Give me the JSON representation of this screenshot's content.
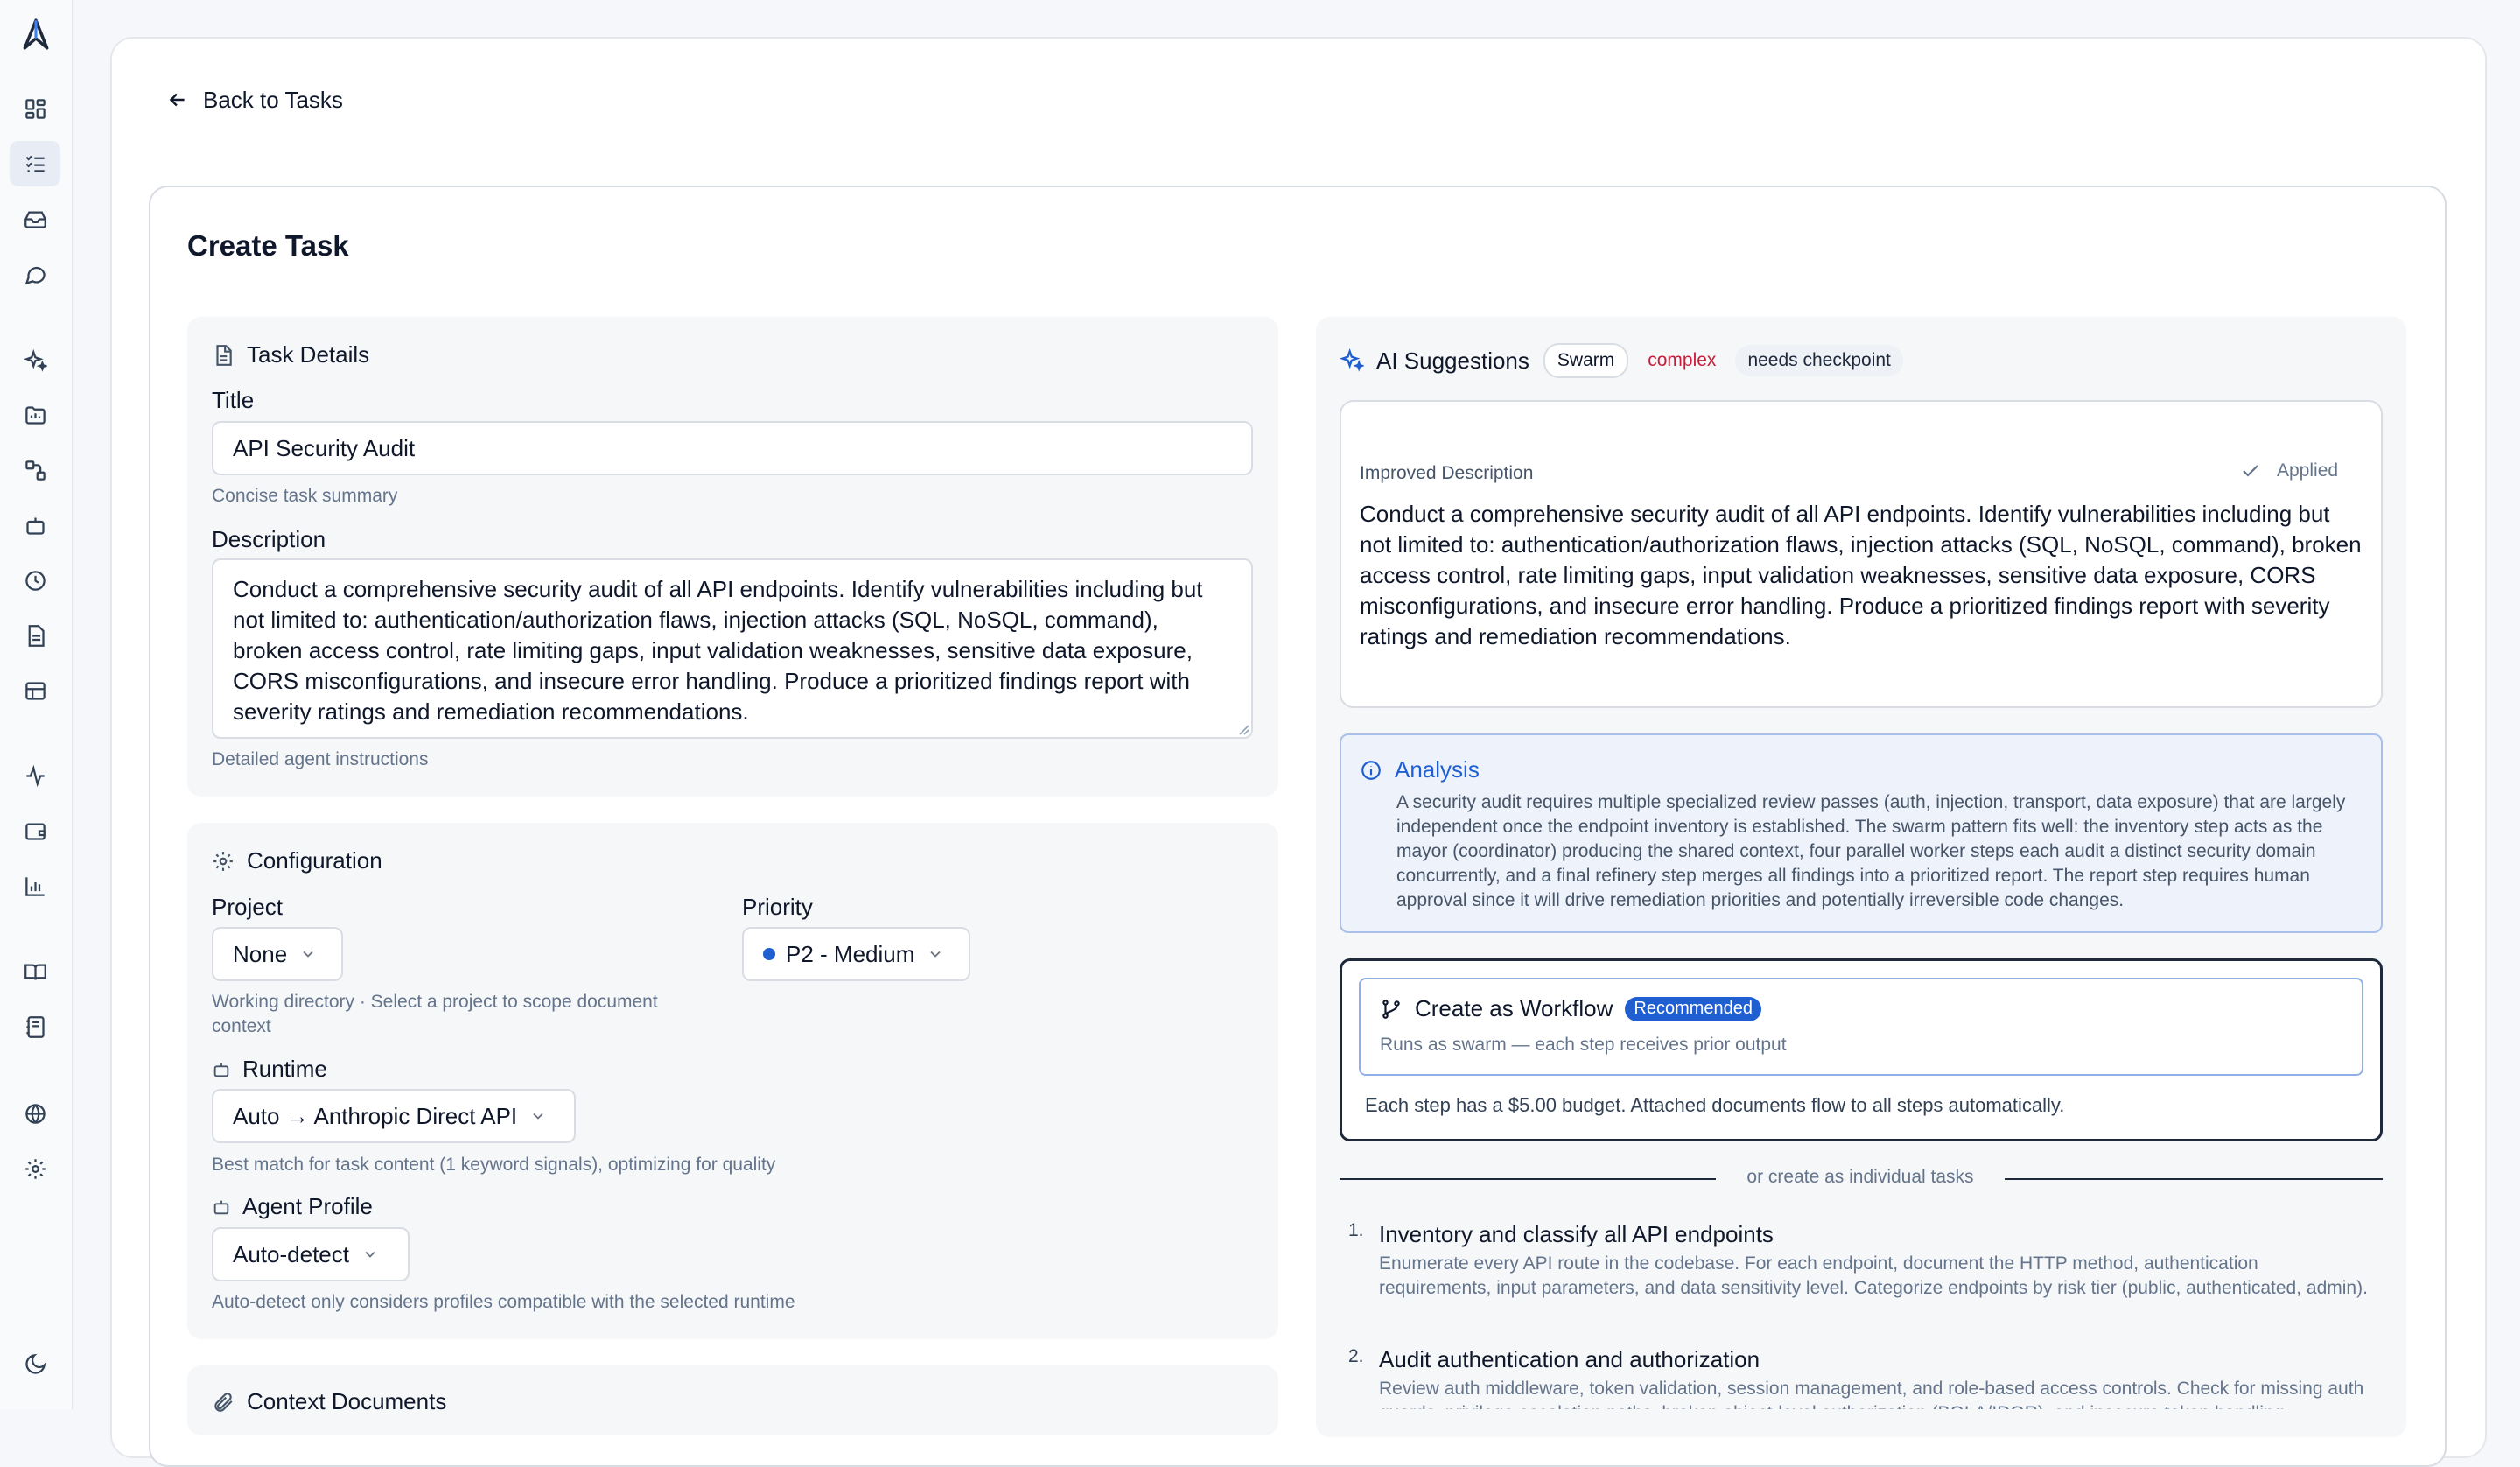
{
  "nav": {
    "back_label": "Back to Tasks"
  },
  "page": {
    "title": "Create Task"
  },
  "task_details": {
    "heading": "Task Details",
    "title_label": "Title",
    "title_value": "API Security Audit",
    "title_hint": "Concise task summary",
    "description_label": "Description",
    "description_value": "Conduct a comprehensive security audit of all API endpoints. Identify vulnerabilities including but not limited to: authentication/authorization flaws, injection attacks (SQL, NoSQL, command), broken access control, rate limiting gaps, input validation weaknesses, sensitive data exposure, CORS misconfigurations, and insecure error handling. Produce a prioritized findings report with severity ratings and remediation recommendations.",
    "description_hint": "Detailed agent instructions"
  },
  "configuration": {
    "heading": "Configuration",
    "project_label": "Project",
    "project_value": "None",
    "project_hint": "Working directory · Select a project to scope document context",
    "priority_label": "Priority",
    "priority_value": "P2 - Medium",
    "priority_color": "#1f5fd1",
    "runtime_label": "Runtime",
    "runtime_value": "Auto → Anthropic Direct API",
    "runtime_hint": "Best match for task content (1 keyword signals), optimizing for quality",
    "agent_label": "Agent Profile",
    "agent_value": "Auto-detect",
    "agent_hint": "Auto-detect only considers profiles compatible with the selected runtime"
  },
  "context_documents": {
    "heading": "Context Documents"
  },
  "ai": {
    "heading": "AI Suggestions",
    "tags": {
      "swarm": "Swarm",
      "complex": "complex",
      "checkpoint": "needs checkpoint"
    },
    "improved_label": "Improved Description",
    "applied_label": "Applied",
    "improved_text": "Conduct a comprehensive security audit of all API endpoints. Identify vulnerabilities including but not limited to: authentication/authorization flaws, injection attacks (SQL, NoSQL, command), broken access control, rate limiting gaps, input validation weaknesses, sensitive data exposure, CORS misconfigurations, and insecure error handling. Produce a prioritized findings report with severity ratings and remediation recommendations.",
    "analysis_title": "Analysis",
    "analysis_text": "A security audit requires multiple specialized review passes (auth, injection, transport, data exposure) that are largely independent once the endpoint inventory is established. The swarm pattern fits well: the inventory step acts as the mayor (coordinator) producing the shared context, four parallel worker steps each audit a distinct security domain concurrently, and a final refinery step merges all findings into a prioritized report. The report step requires human approval since it will drive remediation priorities and potentially irreversible code changes.",
    "workflow_title": "Create as Workflow",
    "workflow_badge": "Recommended",
    "workflow_sub": "Runs as swarm — each step receives prior output",
    "budget_text": "Each step has a $5.00 budget. Attached documents flow to all steps automatically.",
    "divider_text": "or create as individual tasks",
    "tasks": [
      {
        "num": "1.",
        "title": "Inventory and classify all API endpoints",
        "desc": "Enumerate every API route in the codebase. For each endpoint, document the HTTP method, authentication requirements, input parameters, and data sensitivity level. Categorize endpoints by risk tier (public, authenticated, admin)."
      },
      {
        "num": "2.",
        "title": "Audit authentication and authorization",
        "desc": "Review auth middleware, token validation, session management, and role-based access controls. Check for missing auth guards, privilege escalation paths, broken object-level authorization (BOLA/IDOR), and insecure token handling."
      }
    ]
  },
  "colors": {
    "accent": "#1f5fd1",
    "danger": "#c81e3a",
    "analysis_bg": "#edf2fb",
    "analysis_border": "#a9c1ea"
  }
}
